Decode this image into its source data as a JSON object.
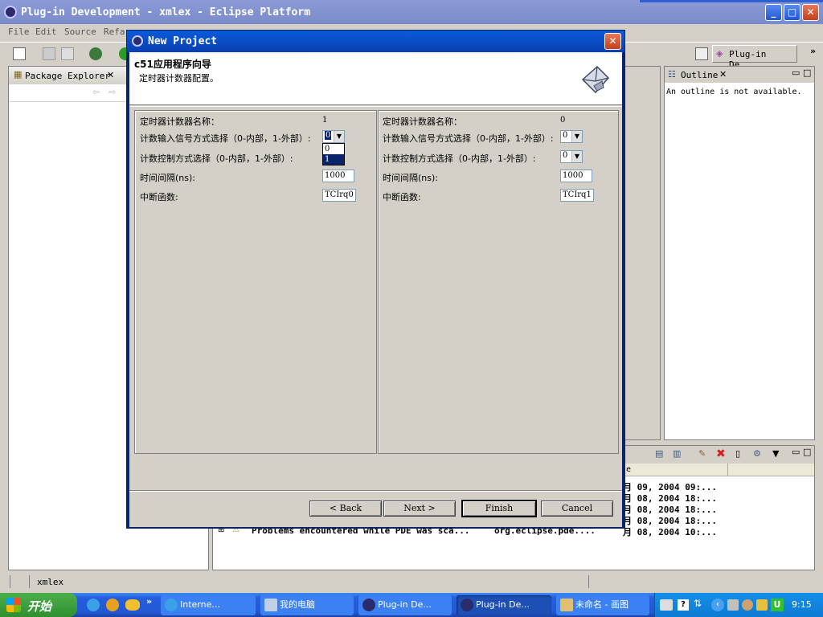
{
  "main_window": {
    "title": "Plug-in Development - xmlex - Eclipse Platform",
    "menu": [
      "File",
      "Edit",
      "Source",
      "Refa"
    ],
    "perspective": "Plug-in De...",
    "overflow": "»"
  },
  "package_explorer": {
    "title": "Package Explorer"
  },
  "outline": {
    "title": "Outline",
    "message": "An outline is not available."
  },
  "problems": {
    "header_fragment": "e",
    "rows": [
      {
        "date": "月 09, 2004 09:..."
      },
      {
        "date": "月 08, 2004 18:..."
      },
      {
        "date": "月 08, 2004 18:..."
      },
      {
        "date": "月 08, 2004 18:..."
      },
      {
        "date": "月 08, 2004 18:..."
      }
    ],
    "last_row": {
      "text": "Problems encountered while PDE was sca...",
      "resource": "org.eclipse.pde....",
      "date": "月 08, 2004 10:..."
    }
  },
  "status_bar": {
    "text": "xmlex"
  },
  "dialog": {
    "title": "New Project",
    "header_title": "c51应用程序向导",
    "header_desc": "定时器计数器配置。",
    "labels": {
      "name": "定时器计数器名称：",
      "input_mode": "计数输入信号方式选择（0-内部，1-外部）:",
      "control_mode": "计数控制方式选择（0-内部，1-外部）:",
      "interval": "时间间隔(ns):",
      "interrupt": "中断函数:"
    },
    "left": {
      "name_value": "1",
      "input_mode": "0",
      "control_mode": "",
      "interval": "1000",
      "interrupt": "TCIrq0",
      "dropdown_options": [
        "0",
        "1"
      ]
    },
    "right": {
      "name_value": "0",
      "input_mode": "0",
      "control_mode": "0",
      "interval": "1000",
      "interrupt": "TCIrq1"
    },
    "buttons": {
      "back": "< Back",
      "next": "Next >",
      "finish": "Finish",
      "cancel": "Cancel"
    }
  },
  "taskbar": {
    "start": "开始",
    "items": [
      {
        "label": "Interne..."
      },
      {
        "label": "我的电脑"
      },
      {
        "label": "Plug-in De..."
      },
      {
        "label": "Plug-in De..."
      },
      {
        "label": "未命名 - 画图"
      }
    ],
    "clock": "9:15",
    "quicklaunch_more": "»"
  }
}
